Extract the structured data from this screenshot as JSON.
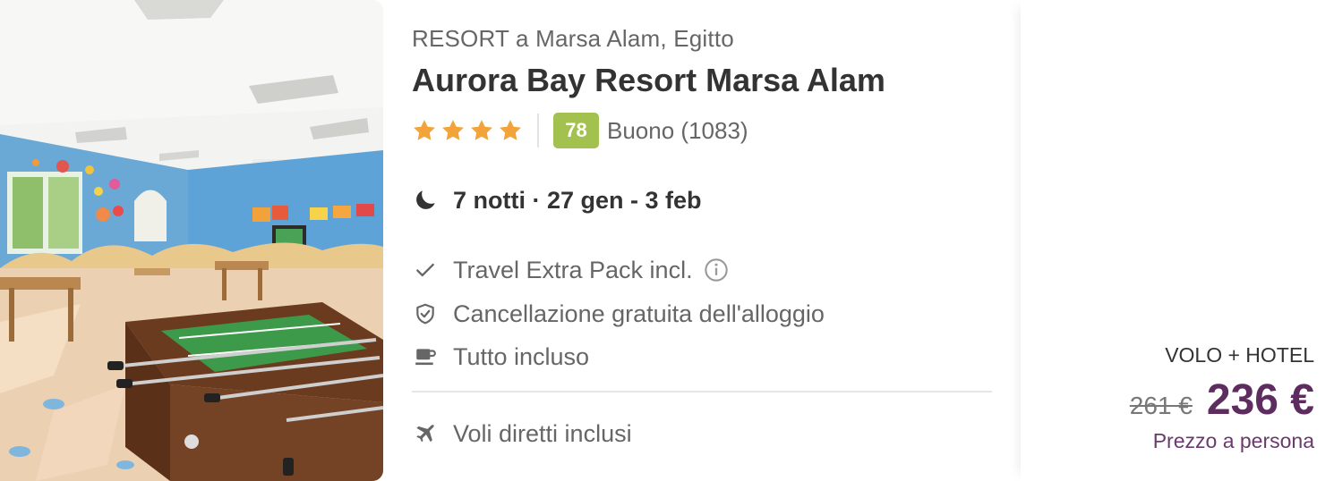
{
  "hotel": {
    "location": "RESORT a Marsa Alam, Egitto",
    "name": "Aurora Bay Resort Marsa Alam",
    "stars": 4,
    "score": "78",
    "score_label": "Buono (1083)"
  },
  "stay": {
    "icon": "moon-icon",
    "text": "7 notti · 27 gen - 3 feb"
  },
  "features": [
    {
      "icon": "check-icon",
      "text": "Travel Extra Pack incl.",
      "has_info": true
    },
    {
      "icon": "shield-check-icon",
      "text": "Cancellazione gratuita dell'alloggio",
      "has_info": false
    },
    {
      "icon": "coffee-cup-icon",
      "text": "Tutto incluso",
      "has_info": false
    }
  ],
  "flight": {
    "icon": "airplane-icon",
    "text": "Voli diretti inclusi"
  },
  "price": {
    "type": "VOLO + HOTEL",
    "old": "261 €",
    "new": "236 €",
    "note": "Prezzo a persona"
  },
  "colors": {
    "star": "#f2a33a",
    "score_bg": "#a3c14f",
    "price": "#5d2d5f",
    "text_dark": "#333333",
    "text_muted": "#666666"
  }
}
